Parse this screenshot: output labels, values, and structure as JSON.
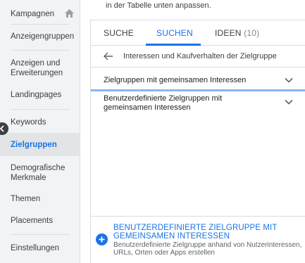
{
  "hint": "in der Tabelle unten anpassen.",
  "sidebar": {
    "items": [
      {
        "label": "Kampagnen"
      },
      {
        "label": "Anzeigengruppen"
      },
      {
        "label": "Anzeigen und Erweiterungen"
      },
      {
        "label": "Landingpages"
      },
      {
        "label": "Keywords"
      },
      {
        "label": "Zielgruppen"
      },
      {
        "label": "Demografische Merkmale"
      },
      {
        "label": "Themen"
      },
      {
        "label": "Placements"
      },
      {
        "label": "Einstellungen"
      }
    ],
    "active_item": "Zielgruppen"
  },
  "panel": {
    "tabs": [
      {
        "label": "SUCHE"
      },
      {
        "label": "SUCHEN"
      },
      {
        "label": "IDEEN",
        "count": "(10)"
      }
    ],
    "active_tab": "SUCHEN",
    "back_label": "Interessen und Kaufverhalten der Zielgruppe",
    "rows": [
      {
        "label": "Zielgruppen mit gemeinsamen Interessen"
      },
      {
        "label": "Benutzerdefinierte Zielgruppen mit gemeinsamen Interessen"
      }
    ],
    "footer": {
      "title": "BENUTZERDEFINIERTE ZIELGRUPPE MIT GEMEINSAMEN INTERESSEN",
      "description": "Benutzerdefinierte Zielgruppe anhand von Nutzerinteressen, URLs, Orten oder Apps erstellen"
    }
  },
  "colors": {
    "accent": "#1a73e8",
    "sidebar_bg": "#f1f3f4",
    "active_bg": "#e2e4e6",
    "highlight_border": "#8ab4f8"
  },
  "icons": [
    "home-icon",
    "collapse-icon",
    "arrow-back-icon",
    "chevron-down-icon",
    "plus-icon"
  ]
}
